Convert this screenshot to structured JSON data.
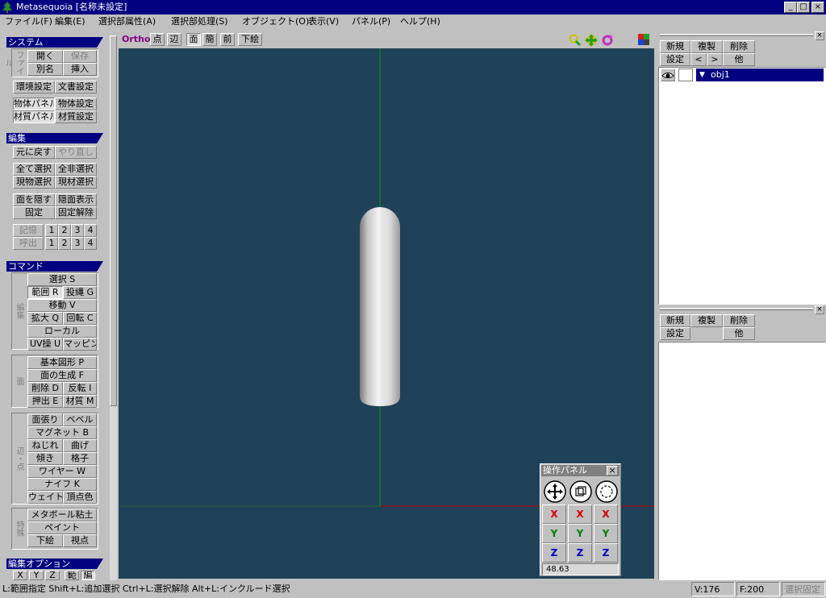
{
  "window": {
    "title": "Metasequoia [名称未設定]",
    "min": "_",
    "max": "□",
    "close": "×"
  },
  "menu": [
    "ファイル(F)",
    "編集(E)",
    "選択部属性(A)",
    "選択部処理(S)",
    "オブジェクト(O)",
    "表示(V)",
    "パネル(P)",
    "ヘルプ(H)"
  ],
  "system": {
    "header": "システム",
    "file_label": "ファイル",
    "open": "開く",
    "save": "保存",
    "save_as": "別名",
    "insert": "挿入",
    "env": "環境設定",
    "doc": "文書設定",
    "obj_panel": "物体パネル",
    "obj_settings": "物体設定",
    "mat_panel": "材質パネル",
    "mat_settings": "材質設定"
  },
  "edit": {
    "header": "編集",
    "undo": "元に戻す",
    "redo": "やり直し",
    "select_all": "全て選択",
    "deselect_all": "全非選択",
    "select_current_obj": "現物選択",
    "select_current_mat": "現材選択",
    "hide_face": "面を隠す",
    "show_hidden": "隠面表示",
    "fix": "固定",
    "unfix": "固定解除",
    "memory": "記憶",
    "recall": "呼出",
    "slots": [
      "1",
      "2",
      "3",
      "4"
    ]
  },
  "command": {
    "header": "コマンド",
    "group_edit": "編集",
    "select": "選択 S",
    "range": "範囲 R",
    "lasso": "投縄 G",
    "move": "移動 V",
    "scale": "拡大 Q",
    "rotate": "回転 C",
    "local": "ローカル",
    "uv": "UV操 U",
    "mapping": "マッピング",
    "group_face": "面",
    "primitive": "基本図形 P",
    "create_face": "面の生成 F",
    "delete": "削除 D",
    "flip": "反転 I",
    "extrude": "押出 E",
    "material": "材質 M",
    "group_edge": "辺・点",
    "face_stretch": "面張り",
    "bevel": "ベベル",
    "magnet": "マグネット B",
    "twist": "ねじれ",
    "bend": "曲げ",
    "tilt": "傾き",
    "lattice": "格子",
    "wire": "ワイヤー W",
    "knife": "ナイフ K",
    "weight": "ウェイト",
    "vertex_color": "頂点色",
    "group_special": "特殊",
    "metaball": "メタボール粘土",
    "paint": "ペイント",
    "underlay": "下絵",
    "viewpoint": "視点"
  },
  "edit_options": {
    "header": "編集オプション",
    "x": "X",
    "y": "Y",
    "z": "Z",
    "range": "範",
    "edit": "編"
  },
  "view_toolbar": {
    "ortho": "Ortho",
    "point": "点",
    "edge": "辺",
    "face": "面",
    "simple": "簡",
    "front": "前",
    "underlay": "下絵"
  },
  "object_panel": {
    "new": "新規",
    "copy": "複製",
    "delete": "削除",
    "settings": "設定",
    "prev": "<",
    "next": ">",
    "other": "他",
    "objects": [
      {
        "name": "obj1",
        "visible": true
      }
    ]
  },
  "material_panel": {
    "new": "新規",
    "copy": "複製",
    "delete": "削除",
    "settings": "設定",
    "other": "他"
  },
  "op_panel": {
    "title": "操作パネル",
    "close": "×",
    "x": "X",
    "y": "Y",
    "z": "Z",
    "value": "48.63"
  },
  "status": {
    "hint": "L:範囲指定 Shift+L:追加選択 Ctrl+L:選択解除 Alt+L:インクルード選択",
    "vertices": "V:176",
    "faces": "F:200",
    "fix_selection": "選択固定"
  },
  "colors": {
    "viewport_bg": "#1f4259",
    "axis_x": "#c00000",
    "axis_y": "#00a000",
    "title_bg": "#000080",
    "selected_row": "#000080"
  }
}
